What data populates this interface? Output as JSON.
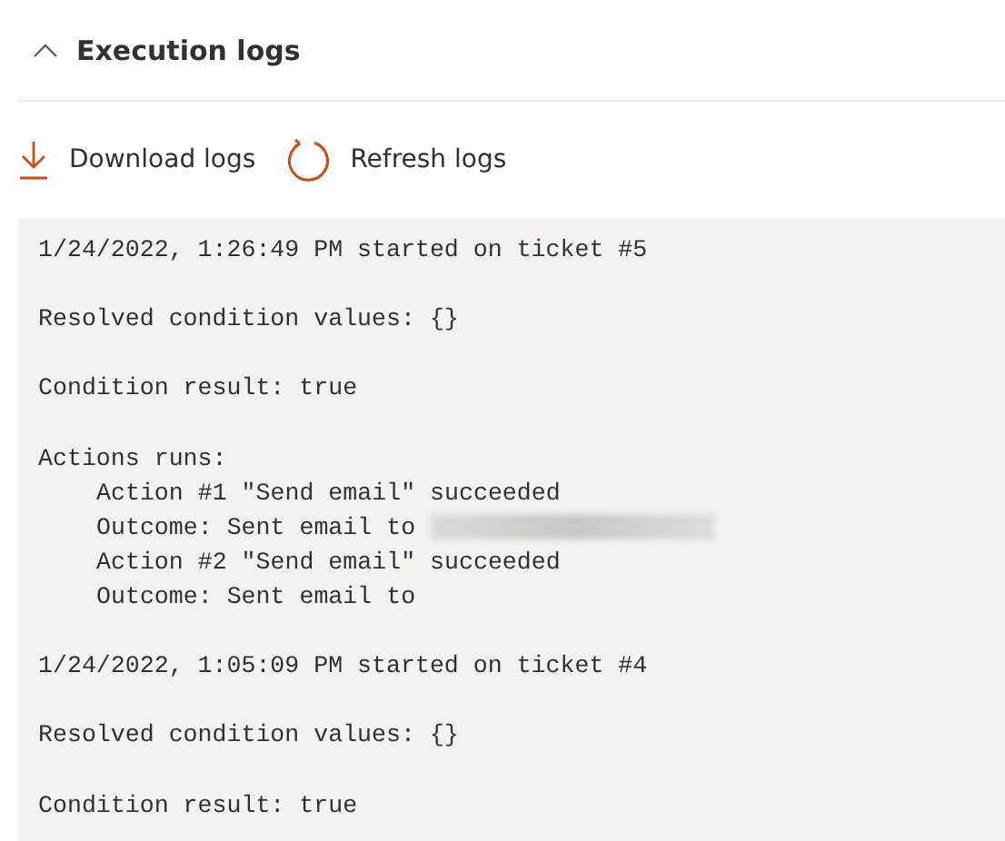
{
  "section": {
    "title": "Execution logs",
    "expanded": true
  },
  "toolbar": [
    {
      "kind": "download",
      "label": "Download logs"
    },
    {
      "kind": "refresh",
      "label": "Refresh logs"
    }
  ],
  "log": [
    {
      "kind": "text",
      "text": "1/24/2022, 1:26:49 PM started on ticket #5",
      "redacted": false
    },
    {
      "kind": "blank"
    },
    {
      "kind": "text",
      "text": "Resolved condition values: {}",
      "redacted": false
    },
    {
      "kind": "blank"
    },
    {
      "kind": "text",
      "text": "Condition result: true",
      "redacted": false
    },
    {
      "kind": "blank"
    },
    {
      "kind": "text",
      "text": "Actions runs:",
      "redacted": false
    },
    {
      "kind": "indented",
      "text": "Action #1 \"Send email\" succeeded",
      "redacted": false
    },
    {
      "kind": "indented",
      "text": "Outcome: Sent email to",
      "redacted": true
    },
    {
      "kind": "indented",
      "text": "Action #2 \"Send email\" succeeded",
      "redacted": false
    },
    {
      "kind": "indented",
      "text": "Outcome: Sent email to",
      "redacted": false
    },
    {
      "kind": "blank"
    },
    {
      "kind": "text",
      "text": "1/24/2022, 1:05:09 PM started on ticket #4",
      "redacted": false
    },
    {
      "kind": "blank"
    },
    {
      "kind": "text",
      "text": "Resolved condition values: {}",
      "redacted": false
    },
    {
      "kind": "blank"
    },
    {
      "kind": "text",
      "text": "Condition result: true",
      "redacted": false
    }
  ]
}
